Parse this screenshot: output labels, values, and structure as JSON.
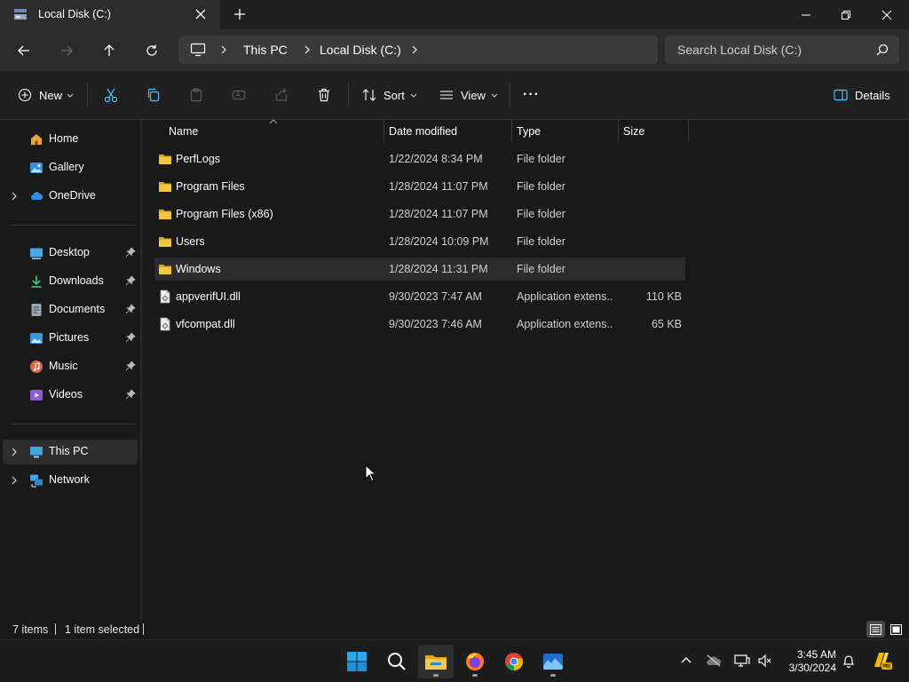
{
  "window": {
    "tab_title": "Local Disk (C:)",
    "new_tab": "+"
  },
  "address": {
    "crumbs": [
      "This PC",
      "Local Disk (C:)"
    ],
    "search_placeholder": "Search Local Disk (C:)"
  },
  "commands": {
    "new": "New",
    "sort": "Sort",
    "view": "View",
    "more": "···",
    "details": "Details"
  },
  "nav": {
    "quick": [
      {
        "label": "Home",
        "icon": "home-icon",
        "color": "#e8a33d"
      },
      {
        "label": "Gallery",
        "icon": "gallery-icon",
        "color": "#3a8fdc"
      },
      {
        "label": "OneDrive",
        "icon": "onedrive-icon",
        "color": "#2f8ee6"
      }
    ],
    "pinned": [
      {
        "label": "Desktop",
        "icon": "desktop-icon",
        "color": "#4aa4e8"
      },
      {
        "label": "Downloads",
        "icon": "downloads-icon",
        "color": "#3db87a"
      },
      {
        "label": "Documents",
        "icon": "documents-icon",
        "color": "#9aa6b3"
      },
      {
        "label": "Pictures",
        "icon": "pictures-icon",
        "color": "#3a9ae0"
      },
      {
        "label": "Music",
        "icon": "music-icon",
        "color": "#e0664a"
      },
      {
        "label": "Videos",
        "icon": "videos-icon",
        "color": "#8b5cd6"
      }
    ],
    "devices": [
      {
        "label": "This PC",
        "icon": "this-pc-icon",
        "color": "#3fa6e0"
      },
      {
        "label": "Network",
        "icon": "network-icon",
        "color": "#3fa6e0"
      }
    ]
  },
  "columns": {
    "name": "Name",
    "date": "Date modified",
    "type": "Type",
    "size": "Size"
  },
  "files": [
    {
      "name": "PerfLogs",
      "date": "1/22/2024 8:34 PM",
      "type": "File folder",
      "size": "",
      "kind": "folder"
    },
    {
      "name": "Program Files",
      "date": "1/28/2024 11:07 PM",
      "type": "File folder",
      "size": "",
      "kind": "folder"
    },
    {
      "name": "Program Files (x86)",
      "date": "1/28/2024 11:07 PM",
      "type": "File folder",
      "size": "",
      "kind": "folder"
    },
    {
      "name": "Users",
      "date": "1/28/2024 10:09 PM",
      "type": "File folder",
      "size": "",
      "kind": "folder"
    },
    {
      "name": "Windows",
      "date": "1/28/2024 11:31 PM",
      "type": "File folder",
      "size": "",
      "kind": "folder",
      "selected": true
    },
    {
      "name": "appverifUI.dll",
      "date": "9/30/2023 7:47 AM",
      "type": "Application extens...",
      "size": "110 KB",
      "kind": "file"
    },
    {
      "name": "vfcompat.dll",
      "date": "9/30/2023 7:46 AM",
      "type": "Application extens...",
      "size": "65 KB",
      "kind": "file"
    }
  ],
  "status": {
    "items": "7 items",
    "selection": "1 item selected"
  },
  "clock": {
    "time": "3:45 AM",
    "date": "3/30/2024"
  },
  "colors": {
    "folder": "#f4c542",
    "accent": "#4cc2ff",
    "selection": "#2c2c2c"
  }
}
